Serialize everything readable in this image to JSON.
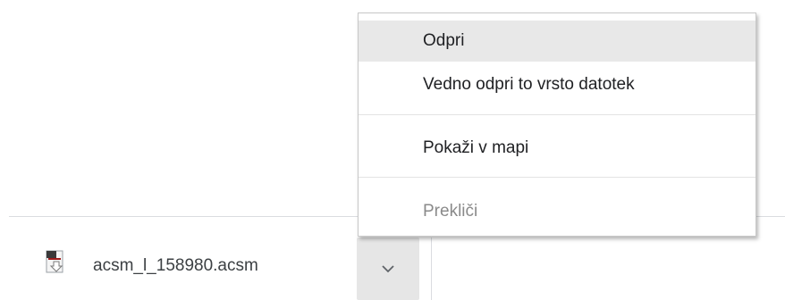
{
  "download_shelf": {
    "file_name": "acsm_l_158980.acsm",
    "file_icon": "acsm-file-icon",
    "menu_toggle_icon": "chevron-down-icon"
  },
  "context_menu": {
    "items": [
      {
        "label": "Odpri",
        "state": "highlighted"
      },
      {
        "label": "Vedno odpri to vrsto datotek",
        "state": "enabled"
      },
      {
        "label": "Pokaži v mapi",
        "state": "enabled"
      },
      {
        "label": "Prekliči",
        "state": "disabled"
      }
    ]
  },
  "colors": {
    "highlight": "#e8e8e8",
    "toggle_background": "#e6e6e6",
    "disabled_text": "#8a8a8a"
  }
}
